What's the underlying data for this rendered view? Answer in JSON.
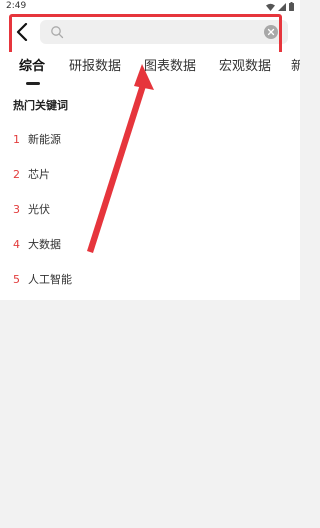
{
  "status_bar": {
    "time": "2:49",
    "icons": [
      "wifi-icon",
      "signal-icon",
      "battery-icon"
    ]
  },
  "search": {
    "placeholder": "",
    "value": ""
  },
  "tabs": [
    {
      "label": "综合",
      "active": true
    },
    {
      "label": "研报数据",
      "active": false
    },
    {
      "label": "图表数据",
      "active": false
    },
    {
      "label": "宏观数据",
      "active": false
    },
    {
      "label": "新",
      "active": false
    }
  ],
  "hot_keywords": {
    "title": "热门关键词",
    "items": [
      {
        "rank": "1",
        "word": "新能源"
      },
      {
        "rank": "2",
        "word": "芯片"
      },
      {
        "rank": "3",
        "word": "光伏"
      },
      {
        "rank": "4",
        "word": "大数据"
      },
      {
        "rank": "5",
        "word": "人工智能"
      }
    ]
  },
  "colors": {
    "accent_red": "#e6353c",
    "rank_red": "#e23c3c",
    "page_bg": "#f2f2f2"
  }
}
